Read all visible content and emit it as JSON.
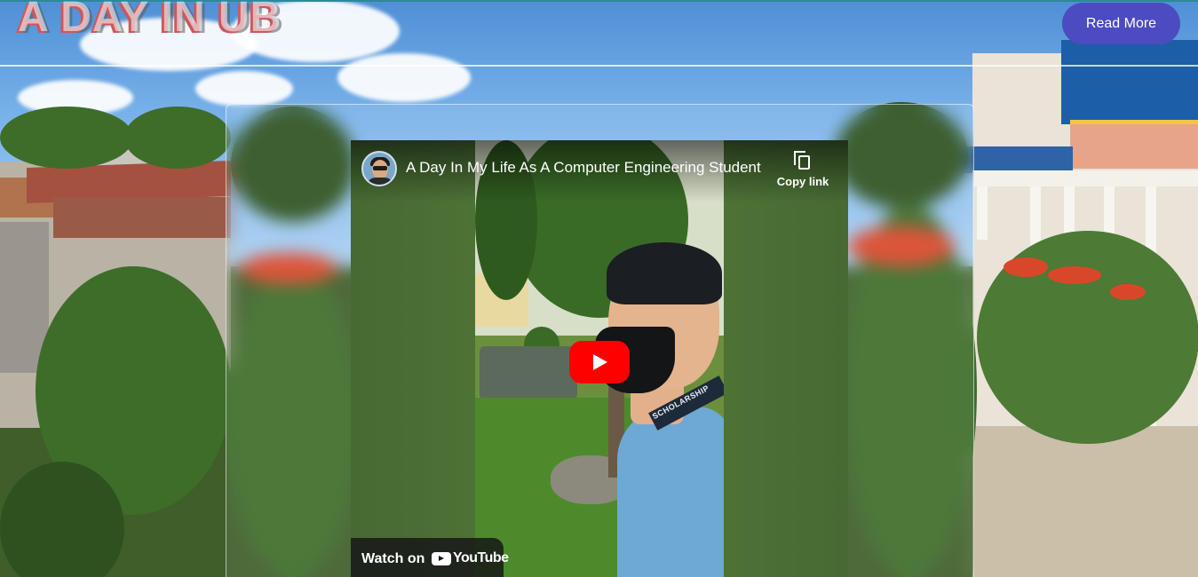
{
  "header": {
    "site_title": "A DAY IN UB",
    "read_more_label": "Read More",
    "accent_color": "#4d4bc0"
  },
  "video": {
    "title": "A Day In My Life As A Computer Engineering Student",
    "copy_link_label": "Copy link",
    "watch_on_label": "Watch on",
    "platform_label": "YouTube",
    "lanyard_text": "SCHOLARSHIP",
    "icons": [
      "channel-avatar",
      "copy-icon",
      "play-icon",
      "youtube-logo-icon"
    ],
    "play_button_color": "#ff0000"
  }
}
